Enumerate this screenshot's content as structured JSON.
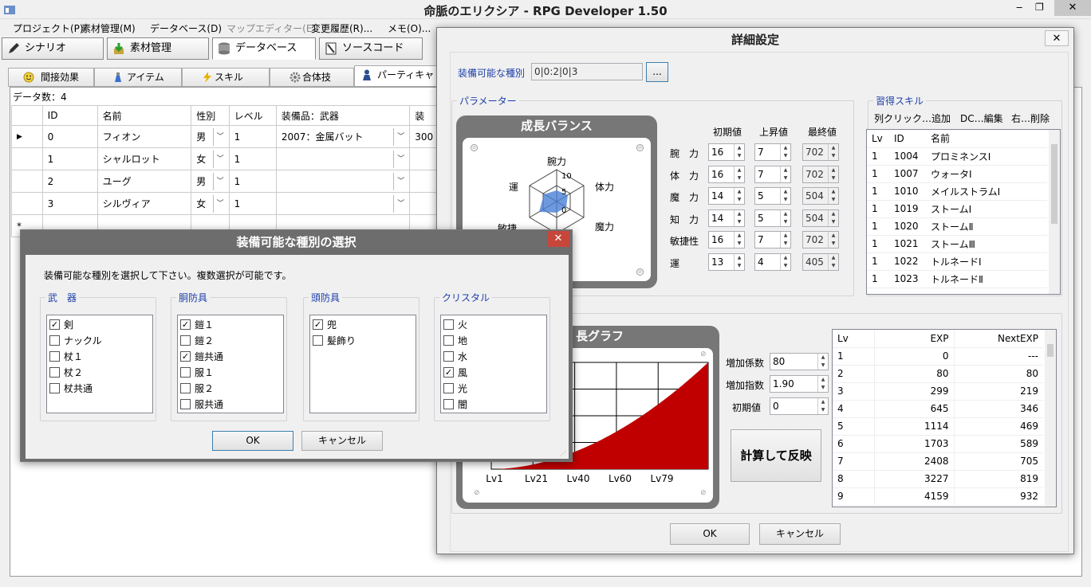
{
  "app_title": "命脈のエリクシア - RPG Developer 1.50",
  "menu": [
    "プロジェクト(P)",
    "素材管理(M)",
    "データベース(D)",
    "マップエディター(E)",
    "変更履歴(R)...",
    "メモ(O)..."
  ],
  "toolbar": [
    "シナリオ",
    "素材管理",
    "データベース",
    "ソースコード"
  ],
  "subtabs": [
    "間接効果",
    "アイテム",
    "スキル",
    "合体技",
    "パーティキャ"
  ],
  "grid": {
    "count_label": "データ数：4",
    "headers": [
      "ID",
      "名前",
      "性別",
      "レベル",
      "装備品：武器",
      "装"
    ],
    "rows": [
      {
        "id": "0",
        "name": "フィオン",
        "sex": "男",
        "level": "1",
        "weapon": "2007：金属バット",
        "extra": "300"
      },
      {
        "id": "1",
        "name": "シャルロット",
        "sex": "女",
        "level": "1",
        "weapon": "",
        "extra": ""
      },
      {
        "id": "2",
        "name": "ユーグ",
        "sex": "男",
        "level": "1",
        "weapon": "",
        "extra": ""
      },
      {
        "id": "3",
        "name": "シルヴィア",
        "sex": "女",
        "level": "1",
        "weapon": "",
        "extra": ""
      }
    ],
    "new_row_marker": "*",
    "current_marker": "▶"
  },
  "detail": {
    "title": "詳細設定",
    "equip_label": "装備可能な種別",
    "equip_value": "0|0:2|0|3",
    "browse_label": "...",
    "param_group": "パラメーター",
    "balance_title": "成長バランス",
    "radar_labels": {
      "top": "腕力",
      "right_top": "体力",
      "right_bottom": "魔力",
      "left_top": "運",
      "left_bottom": "敏捷"
    },
    "radar_scale": [
      "10",
      "5",
      "0"
    ],
    "param_headers": [
      "初期値",
      "上昇値",
      "最終値"
    ],
    "params": [
      {
        "name": "腕　力",
        "init": "16",
        "inc": "7",
        "final": "702"
      },
      {
        "name": "体　力",
        "init": "16",
        "inc": "7",
        "final": "702"
      },
      {
        "name": "魔　力",
        "init": "14",
        "inc": "5",
        "final": "504"
      },
      {
        "name": "知　力",
        "init": "14",
        "inc": "5",
        "final": "504"
      },
      {
        "name": "敏捷性",
        "init": "16",
        "inc": "7",
        "final": "702"
      },
      {
        "name": "運",
        "init": "13",
        "inc": "4",
        "final": "405"
      }
    ],
    "skills_group": "習得スキル",
    "skills_hint": [
      "列クリック…追加",
      "DC…編集",
      "右…削除"
    ],
    "skills_headers": [
      "Lv",
      "ID",
      "名前"
    ],
    "skills": [
      {
        "lv": "1",
        "id": "1004",
        "name": "プロミネンスⅠ"
      },
      {
        "lv": "1",
        "id": "1007",
        "name": "ウォータⅠ"
      },
      {
        "lv": "1",
        "id": "1010",
        "name": "メイルストラムⅠ"
      },
      {
        "lv": "1",
        "id": "1019",
        "name": "ストームⅠ"
      },
      {
        "lv": "1",
        "id": "1020",
        "name": "ストームⅡ"
      },
      {
        "lv": "1",
        "id": "1021",
        "name": "ストームⅢ"
      },
      {
        "lv": "1",
        "id": "1022",
        "name": "トルネードⅠ"
      },
      {
        "lv": "1",
        "id": "1023",
        "name": "トルネードⅡ"
      }
    ],
    "graph_title": "長グラフ",
    "graph_xlabels": [
      "Lv1",
      "Lv21",
      "Lv40",
      "Lv60",
      "Lv79"
    ],
    "coef_label": "増加係数",
    "coef_value": "80",
    "exp_label": "増加指数",
    "exp_value": "1.90",
    "init_label": "初期値",
    "init_value": "0",
    "calc_button": "計算して反映",
    "exp_headers": [
      "Lv",
      "EXP",
      "NextEXP"
    ],
    "exp_rows": [
      {
        "lv": "1",
        "exp": "0",
        "next": "---"
      },
      {
        "lv": "2",
        "exp": "80",
        "next": "80"
      },
      {
        "lv": "3",
        "exp": "299",
        "next": "219"
      },
      {
        "lv": "4",
        "exp": "645",
        "next": "346"
      },
      {
        "lv": "5",
        "exp": "1114",
        "next": "469"
      },
      {
        "lv": "6",
        "exp": "1703",
        "next": "589"
      },
      {
        "lv": "7",
        "exp": "2408",
        "next": "705"
      },
      {
        "lv": "8",
        "exp": "3227",
        "next": "819"
      },
      {
        "lv": "9",
        "exp": "4159",
        "next": "932"
      }
    ],
    "ok": "OK",
    "cancel": "キャンセル"
  },
  "equip_dialog": {
    "title": "装備可能な種別の選択",
    "instruction": "装備可能な種別を選択して下さい。複数選択が可能です。",
    "groups": [
      {
        "label": "武　器",
        "items": [
          {
            "text": "剣",
            "checked": true
          },
          {
            "text": "ナックル",
            "checked": false
          },
          {
            "text": "杖１",
            "checked": false
          },
          {
            "text": "杖２",
            "checked": false
          },
          {
            "text": "杖共通",
            "checked": false
          }
        ]
      },
      {
        "label": "胴防具",
        "items": [
          {
            "text": "鎧１",
            "checked": true
          },
          {
            "text": "鎧２",
            "checked": false
          },
          {
            "text": "鎧共通",
            "checked": true
          },
          {
            "text": "服１",
            "checked": false
          },
          {
            "text": "服２",
            "checked": false
          },
          {
            "text": "服共通",
            "checked": false
          }
        ]
      },
      {
        "label": "頭防具",
        "items": [
          {
            "text": "兜",
            "checked": true
          },
          {
            "text": "髪飾り",
            "checked": false
          }
        ]
      },
      {
        "label": "クリスタル",
        "items": [
          {
            "text": "火",
            "checked": false
          },
          {
            "text": "地",
            "checked": false
          },
          {
            "text": "水",
            "checked": false
          },
          {
            "text": "風",
            "checked": true
          },
          {
            "text": "光",
            "checked": false
          },
          {
            "text": "闇",
            "checked": false
          }
        ]
      }
    ],
    "ok": "OK",
    "cancel": "キャンセル"
  }
}
